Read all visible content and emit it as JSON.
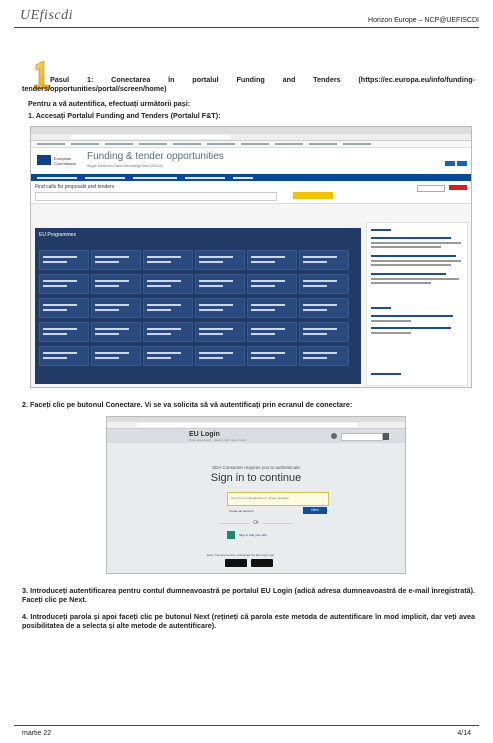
{
  "header": {
    "logo_text": "UEfiscdi",
    "title": "Horizon Europe – NCP@UEFISCDI"
  },
  "step": {
    "number": "1",
    "heading": "Pasul 1: Conectarea în portalul Funding and Tenders (https://ec.europa.eu/info/funding-tenders/opportunities/portal/screen/home)",
    "intro": "Pentru a vă autentifica, efectuați următorii pași:",
    "item1": "1. Accesați Portalul  Funding and Tenders (Portalul F&T):",
    "item2": "2. Faceți clic pe butonul Conectare. Vi se va solicita să vă autentificați prin ecranul de conectare:",
    "item3": "3. Introduceți autentificarea pentru contul dumneavoastră pe portalul EU Login (adică adresa dumneavoastră de e-mail înregistrată). Faceți clic pe Next.",
    "item4": "4. Introduceți parola și apoi faceți clic pe butonul Next (rețineți că parola este metoda de autentificare în mod implicit, dar veți avea posibilitatea de a selecta și alte metode de autentificare)."
  },
  "screenshot1": {
    "site_title": "Funding & tender opportunities",
    "find_title": "Find calls for proposals and tenders",
    "grid_title": "EU Programmes"
  },
  "screenshot2": {
    "title": "EU Login",
    "subtitle": "One account, many EU services",
    "requires": "SDA Consumer requires you to authenticate",
    "sign_in": "Sign in to continue",
    "or": "Or",
    "next_button": "Next"
  },
  "footer": {
    "date": "martie 22",
    "page": "4/14"
  }
}
